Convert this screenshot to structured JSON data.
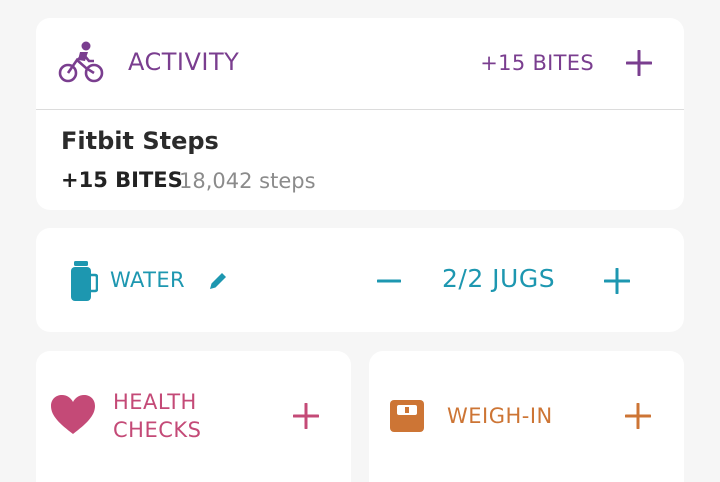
{
  "colors": {
    "activity": "#7a3e8f",
    "water": "#1d97b0",
    "health": "#c44a77",
    "weigh_in": "#cd7535"
  },
  "activity": {
    "icon": "bike-icon",
    "title": "ACTIVITY",
    "bites": "+15 BITES",
    "add_icon": "plus-icon",
    "entry": {
      "name": "Fitbit Steps",
      "bites": "+15 BITES",
      "steps": "18,042 steps"
    }
  },
  "water": {
    "icon": "jug-icon",
    "title": "WATER",
    "edit_icon": "pencil-icon",
    "count": "2/2 JUGS",
    "decrement_icon": "minus-icon",
    "increment_icon": "plus-icon"
  },
  "health": {
    "icon": "heart-icon",
    "title_line1": "HEALTH",
    "title_line2": "CHECKS",
    "add_icon": "plus-icon"
  },
  "weigh_in": {
    "icon": "scale-icon",
    "title": "WEIGH-IN",
    "add_icon": "plus-icon"
  }
}
